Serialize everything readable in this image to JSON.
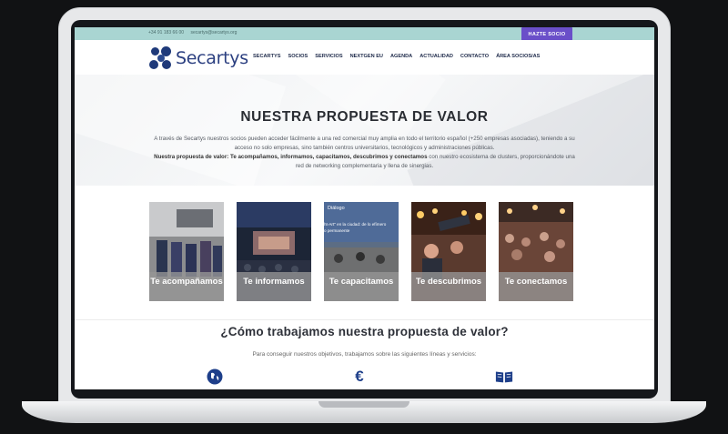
{
  "topbar": {
    "phone": "+34 91 183 66 00",
    "email": "secartys@secartys.org",
    "cta": "HAZTE SOCIO"
  },
  "brand": {
    "name": "Secartys"
  },
  "nav": {
    "items": [
      "SECARTYS",
      "SOCIOS",
      "SERVICIOS",
      "NEXTGEN EU",
      "AGENDA",
      "ACTUALIDAD",
      "CONTACTO",
      "ÁREA SOCIOS/AS"
    ]
  },
  "hero": {
    "title": "NUESTRA PROPUESTA DE VALOR",
    "line1": "A través de Secartys nuestros socios pueden acceder fácilmente a una red comercial muy amplia en todo el territorio español (+250 empresas asociadas), teniendo a su acceso no solo empresas, sino también centros universitarios, tecnológicos y administraciones públicas.",
    "bold": "Nuestra propuesta de valor: Te acompañamos, informamos, capacitamos, descubrimos y conectamos",
    "line2": " con nuestro ecosistema de clusters, proporcionándote una red de networking complementaria y llena de sinergias."
  },
  "cards": [
    {
      "label": "Te acompañamos"
    },
    {
      "label": "Te informamos"
    },
    {
      "label": "Te capacitamos",
      "photo_text": [
        "Diálogo",
        "ht-Art\" en la ciudad: de lo efímero",
        "o permanente"
      ]
    },
    {
      "label": "Te descubrimos"
    },
    {
      "label": "Te conectamos"
    }
  ],
  "section": {
    "title": "¿Cómo trabajamos nuestra propuesta de valor?",
    "subtitle": "Para conseguir nuestros objetivos, trabajamos sobre las siguientes líneas y servicios:"
  },
  "services": [
    {
      "icon": "globe-icon"
    },
    {
      "icon": "euro-icon",
      "symbol": "€"
    },
    {
      "icon": "book-icon"
    }
  ],
  "colors": {
    "topbar": "#a9d5d2",
    "cta": "#6a4fc9",
    "brand": "#2b3f80",
    "icon_blue": "#1e3f8a"
  }
}
